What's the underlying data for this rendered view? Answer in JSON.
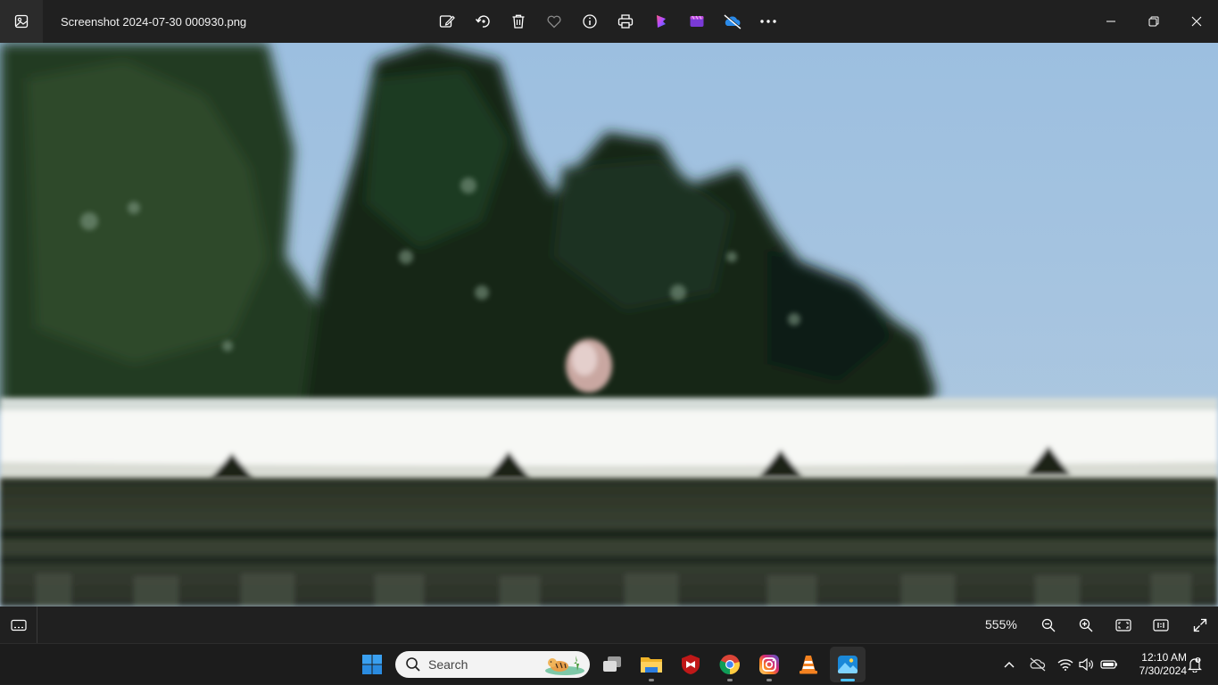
{
  "window": {
    "file_name": "Screenshot 2024-07-30 000930.png"
  },
  "toolbar": [
    {
      "name": "edit-image-icon"
    },
    {
      "name": "rotate-icon"
    },
    {
      "name": "delete-icon"
    },
    {
      "name": "favorite-icon"
    },
    {
      "name": "file-info-icon"
    },
    {
      "name": "print-icon"
    },
    {
      "name": "clipchamp-icon"
    },
    {
      "name": "video-editor-icon"
    },
    {
      "name": "onedrive-icon"
    },
    {
      "name": "see-more-icon"
    }
  ],
  "statusbar": {
    "zoom": "555%"
  },
  "taskbar": {
    "search_label": "Search",
    "time": "12:10 AM",
    "date": "7/30/2024"
  },
  "colors": {
    "chrome_bg": "#202020",
    "taskbar_bg": "#1c1c1c",
    "sky": "#9ec0de",
    "accent": "#4cc2ff"
  }
}
